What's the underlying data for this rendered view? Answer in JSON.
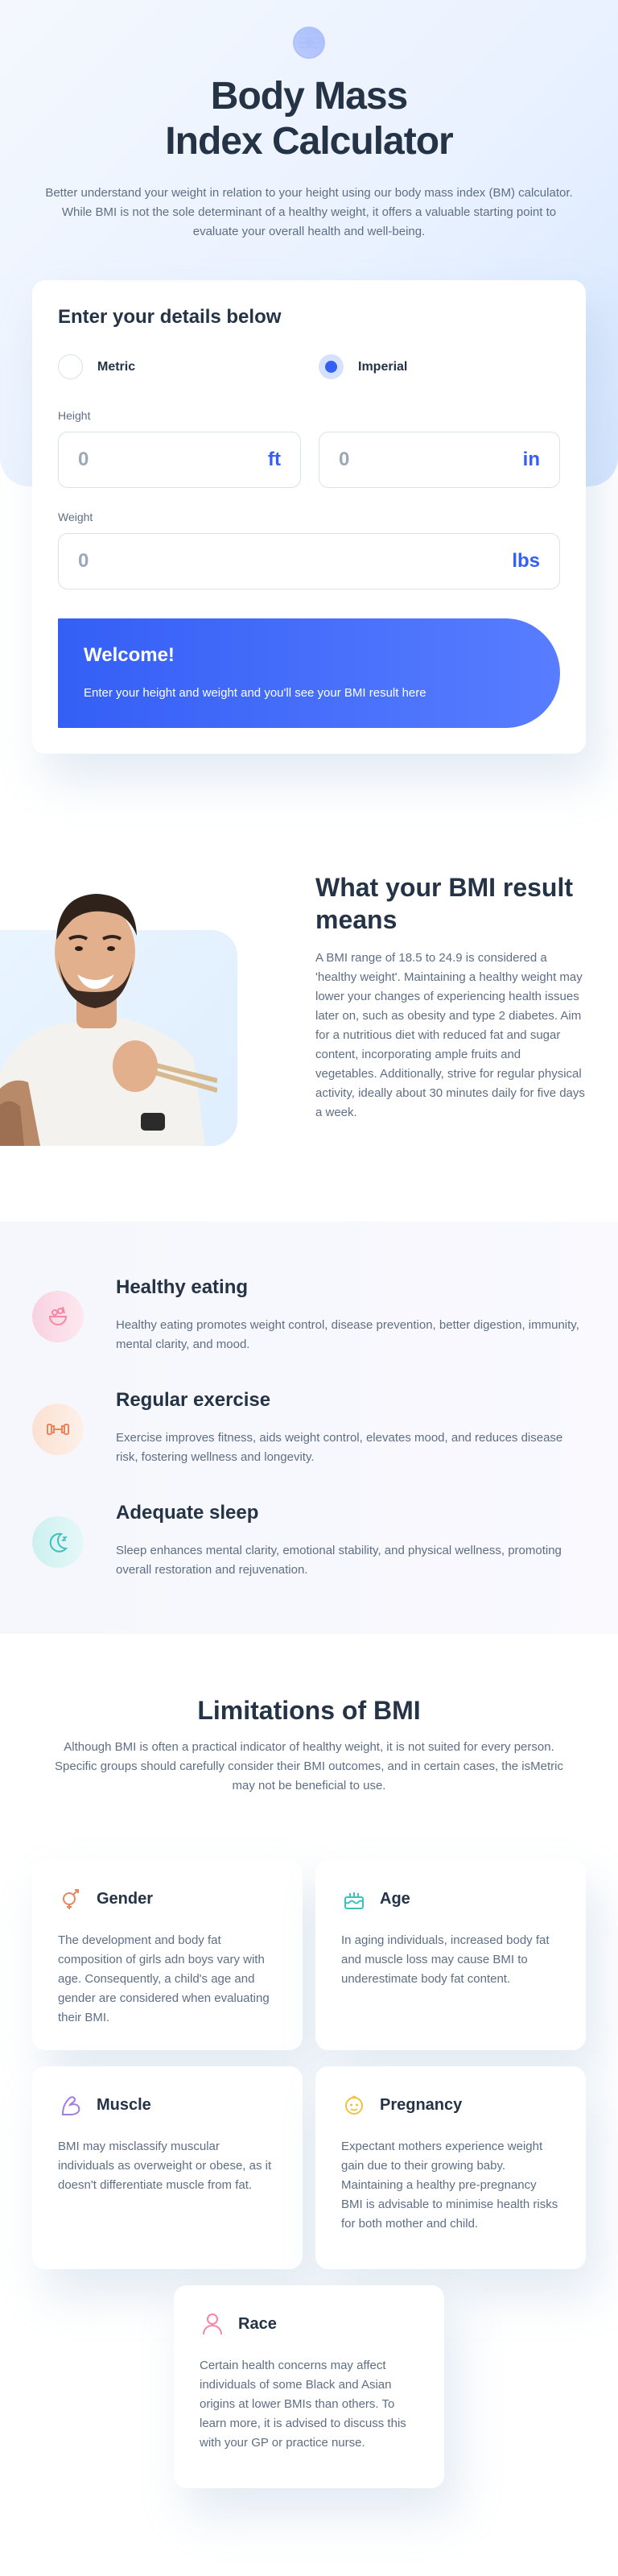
{
  "hero": {
    "title_line1": "Body Mass",
    "title_line2": "Index Calculator",
    "subtitle": "Better understand your weight in relation to your height using our body mass index (BM) calculator. While BMI is not the sole determinant of a healthy weight, it offers a valuable starting point to evaluate your overall health and well-being."
  },
  "calculator": {
    "title": "Enter your details below",
    "units": {
      "metric_label": "Metric",
      "imperial_label": "Imperial",
      "selected": "Imperial"
    },
    "height_label": "Height",
    "height_ft": {
      "value": "0",
      "unit": "ft"
    },
    "height_in": {
      "value": "0",
      "unit": "in"
    },
    "weight_label": "Weight",
    "weight_lbs": {
      "value": "0",
      "unit": "lbs"
    },
    "result": {
      "title": "Welcome!",
      "text": "Enter your height and weight and you'll see your BMI result here"
    }
  },
  "meaning": {
    "title": "What your BMI result means",
    "text": "A BMI range of 18.5 to 24.9 is considered a 'healthy weight'. Maintaining a healthy weight may lower your changes of experiencing health issues later on, such as obesity and type 2 diabetes. Aim for a nutritious diet with reduced fat and sugar content, incorporating ample fruits and vegetables. Additionally, strive for regular physical activity, ideally about 30 minutes daily for five days a week."
  },
  "tips": [
    {
      "icon": "eating-icon",
      "title": "Healthy eating",
      "text": "Healthy eating promotes weight control, disease prevention, better digestion, immunity, mental clarity, and mood.",
      "color": "#f587a6"
    },
    {
      "icon": "exercise-icon",
      "title": "Regular exercise",
      "text": "Exercise improves fitness, aids weight control, elevates mood, and reduces disease risk, fostering wellness and longevity.",
      "color": "#e7855d"
    },
    {
      "icon": "sleep-icon",
      "title": "Adequate sleep",
      "text": "Sleep enhances mental clarity, emotional stability, and physical wellness, promoting overall restoration and rejuvenation.",
      "color": "#3ec1bb"
    }
  ],
  "limitations": {
    "title": "Limitations of BMI",
    "subtitle": "Although BMI is often a practical indicator of healthy weight, it is not suited for every person. Specific groups should carefully consider their BMI outcomes, and in certain cases, the isMetric may not be beneficial to use.",
    "items": [
      {
        "icon": "gender-icon",
        "title": "Gender",
        "text": "The development and body fat composition of girls adn boys vary with age. Consequently, a child's age and gender are considered when evaluating their BMI."
      },
      {
        "icon": "age-icon",
        "title": "Age",
        "text": "In aging individuals, increased body fat and muscle loss may cause BMI to underestimate body fat content."
      },
      {
        "icon": "muscle-icon",
        "title": "Muscle",
        "text": "BMI may misclassify muscular individuals as overweight or obese, as it doesn't differentiate muscle from fat."
      },
      {
        "icon": "pregnancy-icon",
        "title": "Pregnancy",
        "text": "Expectant mothers experience weight gain due to their growing baby. Maintaining a healthy pre-pregnancy BMI is advisable to minimise health risks for both mother and child."
      },
      {
        "icon": "race-icon",
        "title": "Race",
        "text": "Certain health concerns may affect individuals of some Black and Asian origins at lower BMIs than others. To learn more, it is advised to discuss this with your GP or practice nurse."
      }
    ]
  },
  "colors": {
    "accent": "#345ff6",
    "heading": "#253347",
    "body": "#5e6e85"
  }
}
